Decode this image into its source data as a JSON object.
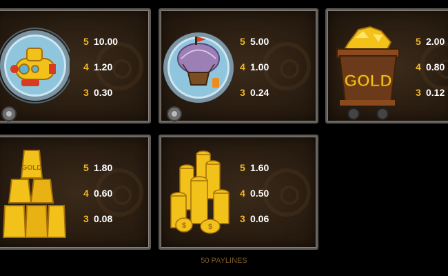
{
  "paytable": [
    {
      "symbol": "submarine-symbol",
      "pays": [
        {
          "count": "5",
          "value": "10.00"
        },
        {
          "count": "4",
          "value": "1.20"
        },
        {
          "count": "3",
          "value": "0.30"
        }
      ]
    },
    {
      "symbol": "airship-symbol",
      "pays": [
        {
          "count": "5",
          "value": "5.00"
        },
        {
          "count": "4",
          "value": "1.00"
        },
        {
          "count": "3",
          "value": "0.24"
        }
      ]
    },
    {
      "symbol": "gold-cart-symbol",
      "cart_label": "GOLD",
      "pays": [
        {
          "count": "5",
          "value": "2.00"
        },
        {
          "count": "4",
          "value": "0.80"
        },
        {
          "count": "3",
          "value": "0.12"
        }
      ]
    },
    {
      "symbol": "gold-bars-symbol",
      "bar_label": "GOLD",
      "pays": [
        {
          "count": "5",
          "value": "1.80"
        },
        {
          "count": "4",
          "value": "0.60"
        },
        {
          "count": "3",
          "value": "0.08"
        }
      ]
    },
    {
      "symbol": "gold-coins-symbol",
      "pays": [
        {
          "count": "5",
          "value": "1.60"
        },
        {
          "count": "4",
          "value": "0.50"
        },
        {
          "count": "3",
          "value": "0.06"
        }
      ]
    }
  ],
  "footer": {
    "paylines_label": "50 PAYLINES"
  },
  "colors": {
    "count": "#f2b824",
    "value": "#ffffff",
    "footer": "#7a5a26",
    "border": "#5e5a55"
  }
}
